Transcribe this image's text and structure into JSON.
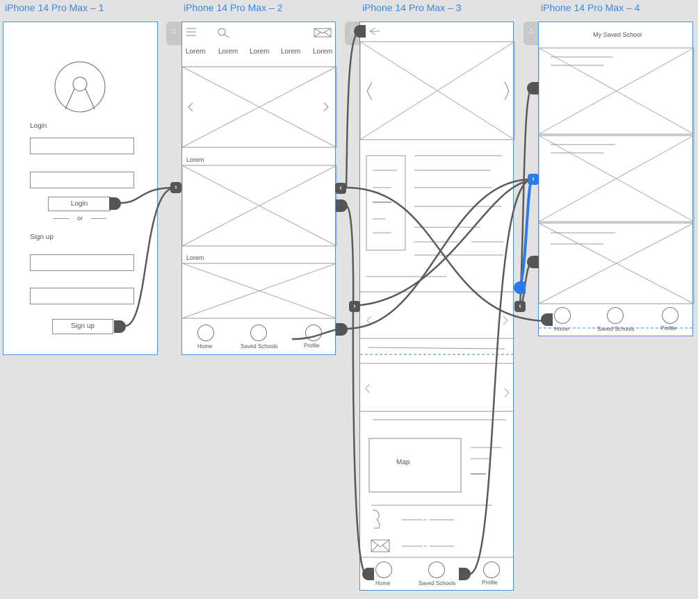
{
  "artboards": [
    {
      "title": "iPhone 14 Pro Max – 1"
    },
    {
      "title": "iPhone 14 Pro Max – 2"
    },
    {
      "title": "iPhone 14 Pro Max – 3"
    },
    {
      "title": "iPhone 14 Pro Max – 4"
    }
  ],
  "screen1": {
    "login_label": "Login",
    "login_button": "Login",
    "or_label": "or",
    "signup_label": "Sign up",
    "signup_button": "Sign up"
  },
  "screen2": {
    "nav": [
      "Lorem",
      "Lorem",
      "Lorem",
      "Lorem",
      "Lorem"
    ],
    "section1_label": "Lorem",
    "section2_label": "Lorem",
    "tabs": [
      "Home",
      "Saved Schools",
      "Profile"
    ]
  },
  "screen3": {
    "map_label": "Map",
    "tabs": [
      "Home",
      "Saved Schools",
      "Profile"
    ]
  },
  "screen4": {
    "title": "My Saved School",
    "tabs": [
      "Home",
      "Saved Schools",
      "Profile"
    ]
  },
  "icons": {
    "home": "home-icon",
    "menu": "hamburger-menu-icon",
    "search": "search-icon",
    "mail": "mail-icon",
    "chevron_right": "chevron-right-icon",
    "chevron_left": "chevron-left-icon",
    "phone": "phone-icon",
    "avatar": "avatar-icon"
  },
  "colors": {
    "canvas": "#e2e2e2",
    "artboard_border": "#4a8fe0",
    "title": "#3b86e0",
    "wire": "#555555",
    "selected_wire": "#2b7bea"
  }
}
